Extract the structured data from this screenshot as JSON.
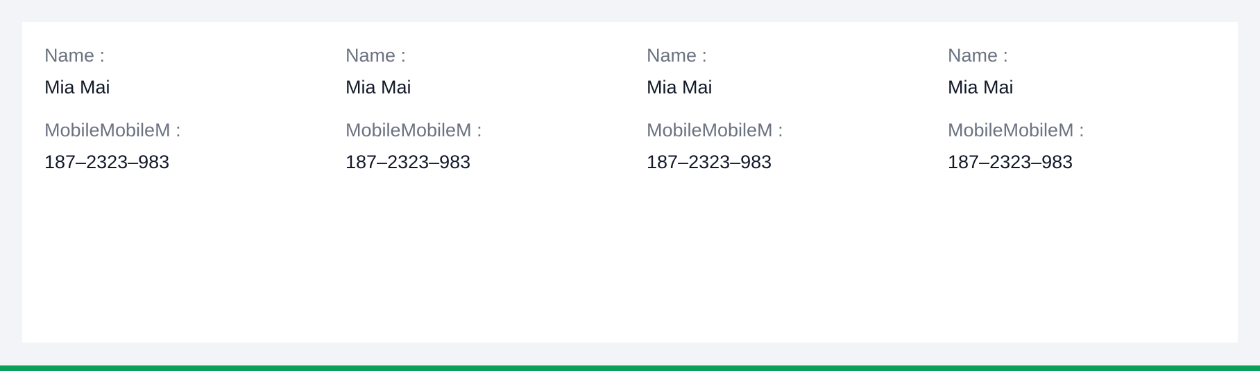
{
  "descriptions": [
    {
      "fields": [
        {
          "label": "Name :",
          "value": "Mia Mai"
        },
        {
          "label": "MobileMobileM :",
          "value": "187–2323–983"
        }
      ]
    },
    {
      "fields": [
        {
          "label": "Name :",
          "value": "Mia Mai"
        },
        {
          "label": "MobileMobileM :",
          "value": "187–2323–983"
        }
      ]
    },
    {
      "fields": [
        {
          "label": "Name :",
          "value": "Mia Mai"
        },
        {
          "label": "MobileMobileM :",
          "value": "187–2323–983"
        }
      ]
    },
    {
      "fields": [
        {
          "label": "Name :",
          "value": "Mia Mai"
        },
        {
          "label": "MobileMobileM :",
          "value": "187–2323–983"
        }
      ]
    }
  ],
  "colors": {
    "background": "#f3f4f7",
    "card": "#ffffff",
    "label": "#6b7280",
    "value": "#111827",
    "accent_bar": "#0aa05c"
  }
}
